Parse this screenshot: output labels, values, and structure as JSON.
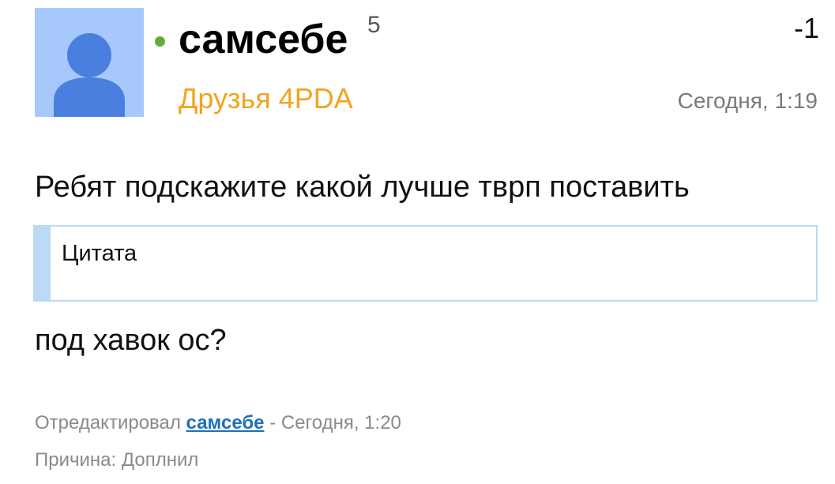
{
  "post": {
    "author": {
      "nickname": "самсебе",
      "reputation": "5",
      "group": "Друзья 4PDA",
      "avatar_icon": "default-user-avatar-icon",
      "status": "online"
    },
    "rating": "-1",
    "timestamp": "Сегодня, 1:19",
    "body": {
      "line1": "Ребят подскажите какой лучше тврп поставить",
      "quote_label": "Цитата",
      "line2": "под хавок ос?"
    },
    "edit": {
      "prefix": "Отредактировал",
      "user": "самсебе",
      "separator": " - ",
      "time": "Сегодня, 1:20"
    },
    "reason": {
      "label": "Причина:",
      "text": "Доплнил"
    }
  },
  "colors": {
    "avatar_bg": "#a6c8fb",
    "avatar_figure": "#4a7fe0",
    "online": "#6aa83a",
    "group": "#f1a420",
    "quote_border": "#bcd9f5",
    "link": "#1f6fb6"
  }
}
